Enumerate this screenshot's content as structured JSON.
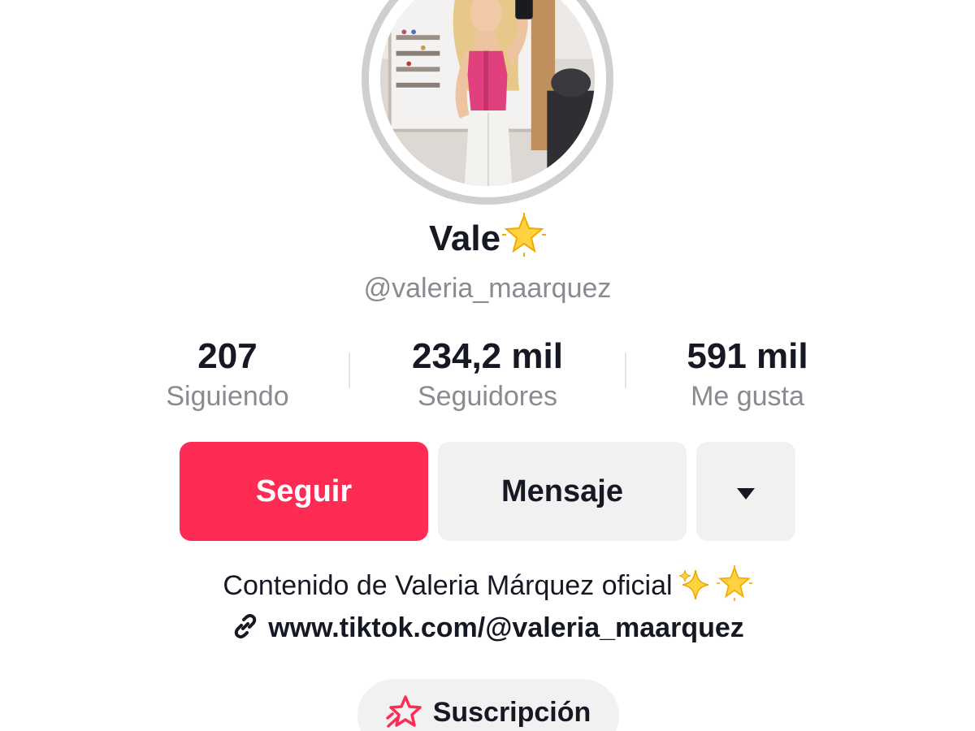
{
  "profile": {
    "display_name": "Vale",
    "name_badge_icon": "glowing-star-icon",
    "handle": "@valeria_maarquez"
  },
  "stats": {
    "following_count": "207",
    "following_label": "Siguiendo",
    "followers_count": "234,2 mil",
    "followers_label": "Seguidores",
    "likes_count": "591 mil",
    "likes_label": "Me gusta"
  },
  "actions": {
    "follow_label": "Seguir",
    "message_label": "Mensaje",
    "more_icon": "caret-down-icon"
  },
  "bio": {
    "text": "Contenido de Valeria Márquez oficial",
    "emojis": [
      "sparkles-icon",
      "glowing-star-icon"
    ],
    "link_icon": "link-icon",
    "link": "www.tiktok.com/@valeria_maarquez"
  },
  "subscription": {
    "icon": "subscription-star-icon",
    "label": "Suscripción"
  },
  "colors": {
    "primary": "#fe2c55",
    "secondary_button": "#f1f1f2",
    "muted_text": "#8a8b91",
    "text": "#161823"
  }
}
